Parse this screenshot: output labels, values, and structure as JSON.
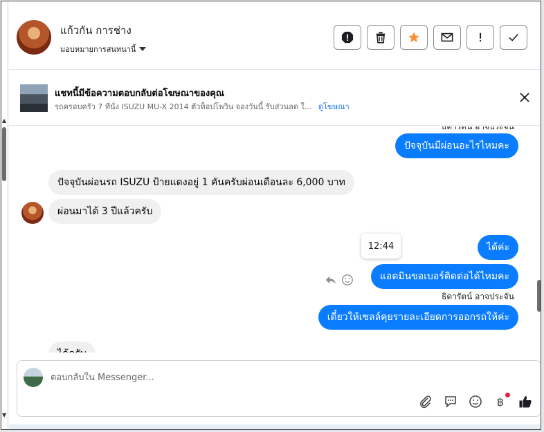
{
  "header": {
    "contact_name": "แก้วกัน การช่าง",
    "assign_label": "มอบหมายการสนทนานี้",
    "actions": [
      "spam-icon",
      "trash-icon",
      "star-icon",
      "envelope-icon",
      "exclamation-icon",
      "check-icon"
    ]
  },
  "ad": {
    "title": "แชทนี้มีข้อความตอบกลับต่อโฆษณาของคุณ",
    "description": "รถครอบครัว 7 ที่นั่ง ISUZU MU-X 2014 ตัวท็อปโพวิน จองวันนี้ รับส่วนลด ใ...",
    "link": "ดูโฆษณา"
  },
  "messages": {
    "m1": "ปัจจุบันมีผ่อนอะไรไหมคะ",
    "m2": "ปัจจุบันผ่อนรถ ISUZU ป้ายแดงอยู่ 1 คันครับผ่อนเดือนละ 6,000 บาท",
    "m3": "ผ่อนมาได้ 3 ปีแล้วครับ",
    "m4": "ได้ค่ะ",
    "m5": "แอดมินขอเบอร์ติดต่อได้ไหมคะ",
    "m6": "เดี๋ยวให้เซลล์คุยรายละเอียดการออกรถให้ค่ะ",
    "m7": "ได้ครับ",
    "sender_top": "ธิดารัตน์ อาจประจัน",
    "sender": "ธิดารัตน์ อาจประจัน",
    "tooltip_time": "12:44"
  },
  "composer": {
    "placeholder": "ตอบกลับใน Messenger...",
    "baht": "฿"
  },
  "colors": {
    "outgoing": "#0a7cff",
    "incoming": "#f0f0f0",
    "link": "#1877f2",
    "accent_star": "#f7923b"
  }
}
